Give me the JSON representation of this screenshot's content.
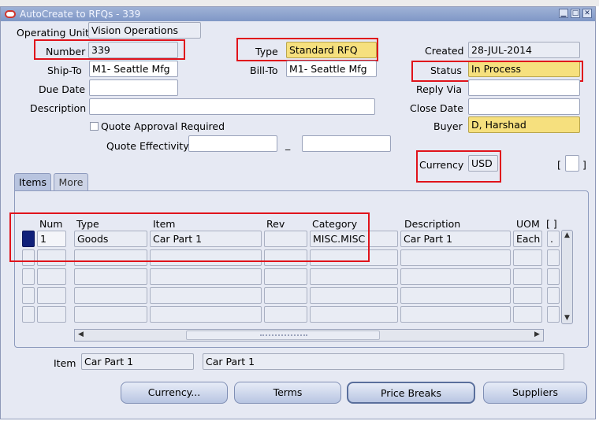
{
  "window": {
    "title": "AutoCreate to RFQs - 339"
  },
  "header": {
    "operating_unit": {
      "label": "Operating Unit",
      "value": "Vision Operations"
    },
    "number": {
      "label": "Number",
      "value": "339"
    },
    "type": {
      "label": "Type",
      "value": "Standard RFQ"
    },
    "created": {
      "label": "Created",
      "value": "28-JUL-2014"
    },
    "ship_to": {
      "label": "Ship-To",
      "value": "M1- Seattle Mfg"
    },
    "bill_to": {
      "label": "Bill-To",
      "value": "M1- Seattle Mfg"
    },
    "status": {
      "label": "Status",
      "value": "In Process"
    },
    "due_date": {
      "label": "Due Date",
      "value": ""
    },
    "reply_via": {
      "label": "Reply Via",
      "value": ""
    },
    "description": {
      "label": "Description",
      "value": ""
    },
    "close_date": {
      "label": "Close Date",
      "value": ""
    },
    "quote_approval": {
      "label": "Quote Approval Required",
      "checked": false
    },
    "buyer": {
      "label": "Buyer",
      "value": "D, Harshad"
    },
    "quote_effectivity": {
      "label": "Quote Effectivity",
      "from": "",
      "separator": "_",
      "to": ""
    },
    "currency": {
      "label": "Currency",
      "value": "USD"
    },
    "flex": {
      "open": "[",
      "close": "]"
    }
  },
  "tabs": [
    {
      "label": "Items",
      "active": true
    },
    {
      "label": "More",
      "active": false
    }
  ],
  "items_table": {
    "columns": [
      "Num",
      "Type",
      "Item",
      "Rev",
      "Category",
      "Description",
      "UOM",
      "[ ]"
    ],
    "rows": [
      {
        "num": "1",
        "type": "Goods",
        "item": "Car Part 1",
        "rev": "",
        "category": "MISC.MISC",
        "description": "Car Part 1",
        "uom": "Each",
        "flex": "."
      },
      {
        "num": "",
        "type": "",
        "item": "",
        "rev": "",
        "category": "",
        "description": "",
        "uom": "",
        "flex": ""
      },
      {
        "num": "",
        "type": "",
        "item": "",
        "rev": "",
        "category": "",
        "description": "",
        "uom": "",
        "flex": ""
      },
      {
        "num": "",
        "type": "",
        "item": "",
        "rev": "",
        "category": "",
        "description": "",
        "uom": "",
        "flex": ""
      },
      {
        "num": "",
        "type": "",
        "item": "",
        "rev": "",
        "category": "",
        "description": "",
        "uom": "",
        "flex": ""
      }
    ]
  },
  "footer": {
    "item_label": "Item",
    "item_value": "Car Part 1",
    "item_description": "Car Part 1"
  },
  "buttons": {
    "currency": "Currency...",
    "terms": "Terms",
    "price_breaks": "Price Breaks",
    "suppliers": "Suppliers"
  },
  "colors": {
    "highlight": "#e0131b",
    "required_field": "#f6e07e",
    "title_bar": "#8aa0cc",
    "selected_row": "#10207a"
  }
}
